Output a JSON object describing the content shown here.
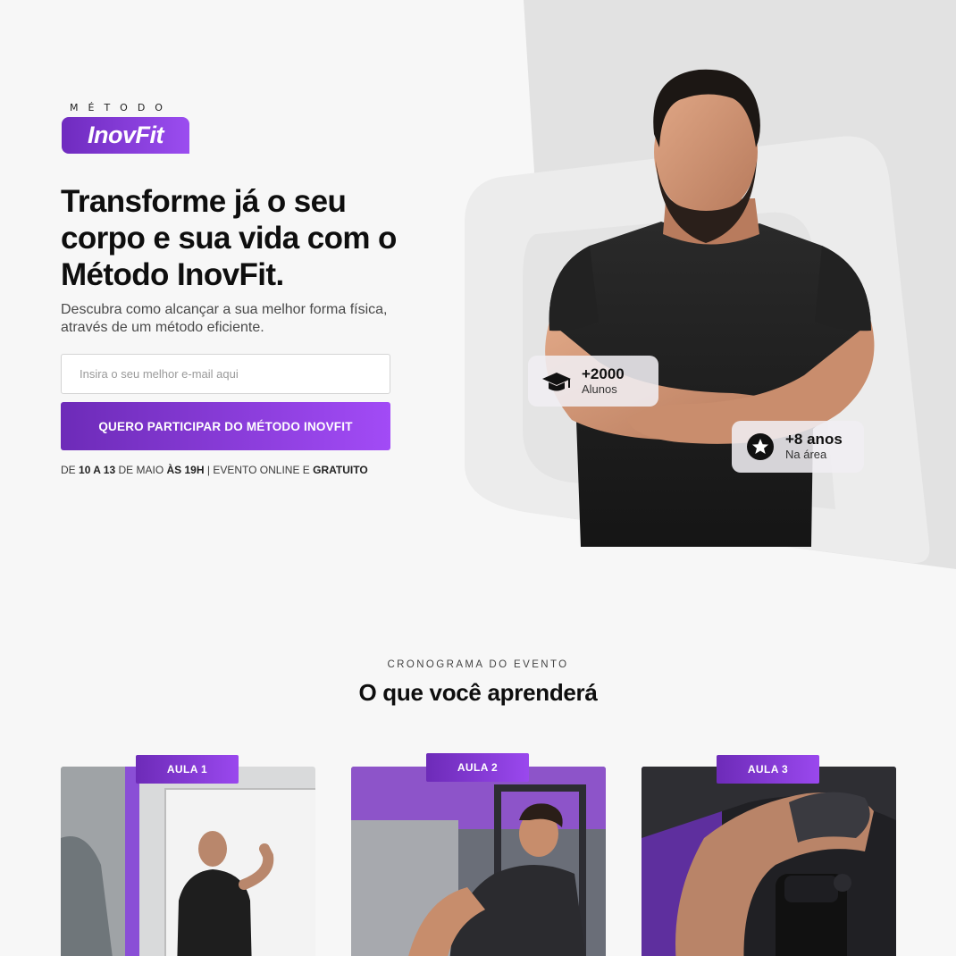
{
  "brand": {
    "kicker": "MÉTODO",
    "name": "InovFit",
    "accent": "#8a3ddc",
    "accent_light": "#a24bf6"
  },
  "hero": {
    "title": "Transforme já o seu corpo e sua vida com o Método InovFit.",
    "subtitle": "Descubra como alcançar a sua melhor forma física, através de um método eficiente.",
    "email_placeholder": "Insira o seu melhor e-mail aqui",
    "email_value": "",
    "cta_label": "QUERO PARTICIPAR DO MÉTODO INOVFIT",
    "event": {
      "prefix": "DE ",
      "dates": "10 A 13",
      "month": " DE MAIO ",
      "time": "ÀS 19H",
      "separator": " | EVENTO ONLINE E ",
      "price": "GRATUITO"
    }
  },
  "stats": [
    {
      "value": "+2000",
      "label": "Alunos",
      "icon": "graduation-cap-icon"
    },
    {
      "value": "+8 anos",
      "label": "Na área",
      "icon": "star-icon"
    }
  ],
  "schedule": {
    "kicker": "CRONOGRAMA DO EVENTO",
    "title": "O que você aprenderá",
    "lessons": [
      {
        "tag": "AULA 1"
      },
      {
        "tag": "AULA 2"
      },
      {
        "tag": "AULA 3"
      }
    ]
  }
}
